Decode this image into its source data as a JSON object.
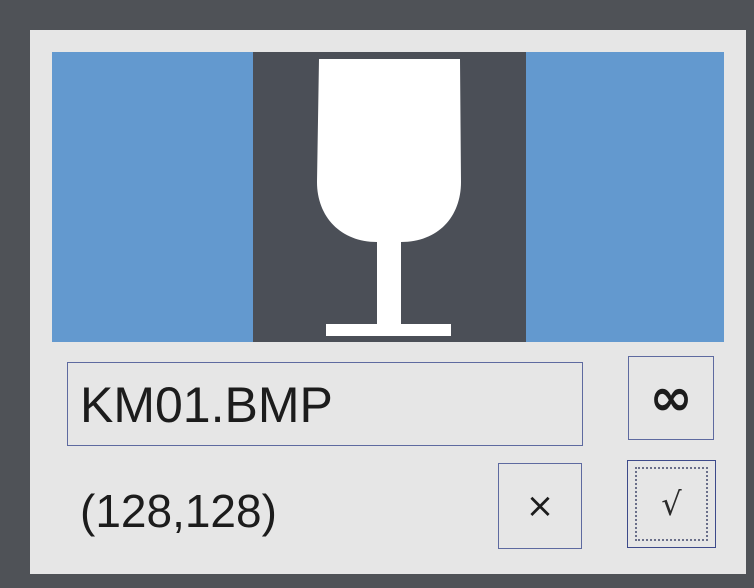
{
  "dialog": {
    "preview": {
      "icon": "wine-glass-icon",
      "background_color": "#6399cf",
      "image_background_color": "#4b4f57",
      "glass_color": "#ffffff"
    },
    "filename": "KM01.BMP",
    "image_size": "(128,128)",
    "buttons": {
      "infinity_label": "∞",
      "cancel_label": "×",
      "ok_label": "√"
    }
  }
}
